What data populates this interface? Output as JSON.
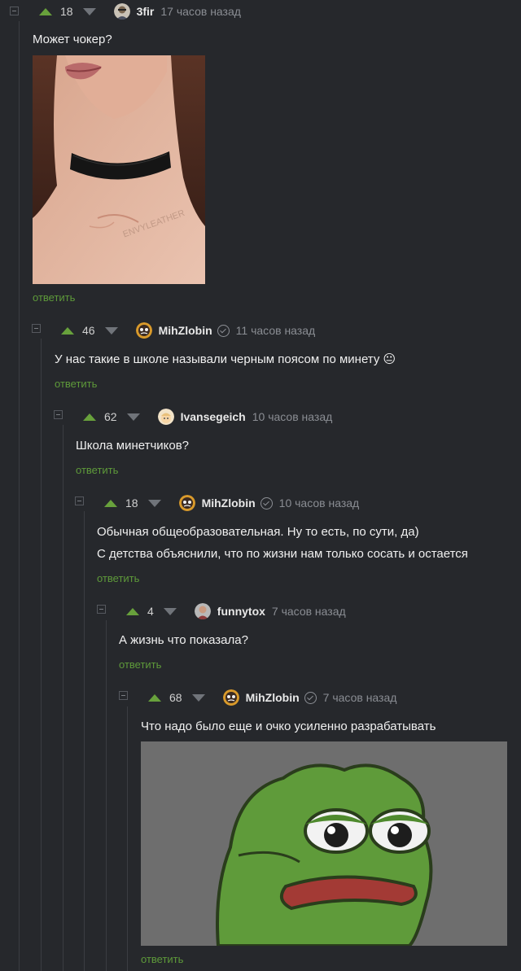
{
  "comments": [
    {
      "rating": "18",
      "user": "3fir",
      "time": "17 часов назад",
      "lines": [
        "Может чокер?"
      ],
      "reply": "ответить",
      "image": "choker-photo"
    },
    {
      "rating": "46",
      "user": "MihZlobin",
      "time": "11 часов назад",
      "lines": [
        "У нас такие в школе называли черным поясом по минету 😐"
      ],
      "reply": "ответить"
    },
    {
      "rating": "62",
      "user": "Ivansegeich",
      "time": "10 часов назад",
      "lines": [
        "Школа минетчиков?"
      ],
      "reply": "ответить"
    },
    {
      "rating": "18",
      "user": "MihZlobin",
      "time": "10 часов назад",
      "lines": [
        "Обычная общеобразовательная. Ну то есть, по сути, да)",
        "С детства объяснили, что по жизни нам только сосать и остается"
      ],
      "reply": "ответить"
    },
    {
      "rating": "4",
      "user": "funnytox",
      "time": "7 часов назад",
      "lines": [
        "А жизнь что показала?"
      ],
      "reply": "ответить"
    },
    {
      "rating": "68",
      "user": "MihZlobin",
      "time": "7 часов назад",
      "lines": [
        "Что надо было еще и очко усиленно разрабатывать"
      ],
      "reply": "ответить",
      "image": "sad-frog-picture"
    }
  ],
  "photo_watermark": "ENVYLEATHER",
  "colors": {
    "background": "#26282c",
    "upvote": "#68a13c",
    "reply_link": "#5e9a3a"
  }
}
